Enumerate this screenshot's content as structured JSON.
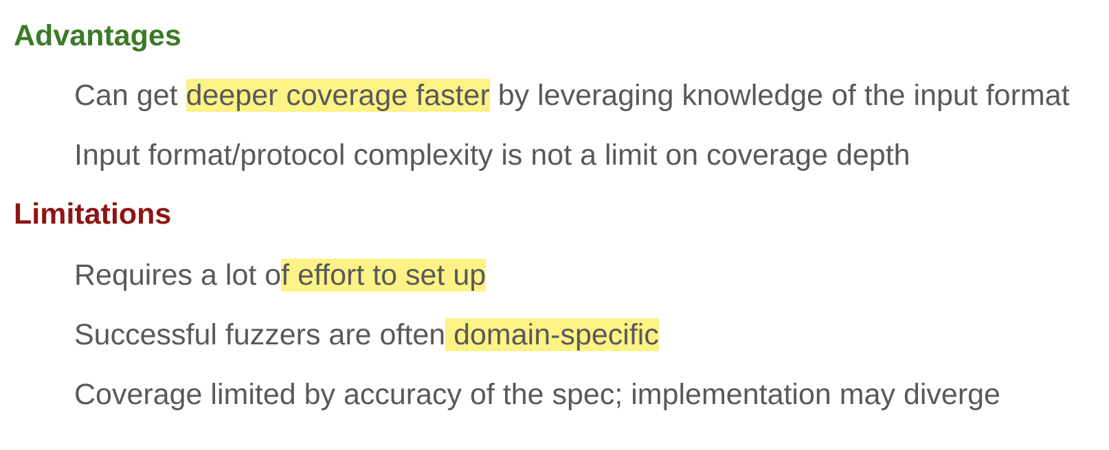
{
  "colors": {
    "advantages_heading": "#3b7a26",
    "limitations_heading": "#8f1414",
    "body_text": "#595959",
    "highlight": "#fcf286"
  },
  "advantages": {
    "heading": "Advantages",
    "items": [
      {
        "before": "Can get ",
        "highlight": "deeper coverage faster",
        "after": " by leveraging knowledge of the input format"
      },
      {
        "before": "Input format/protocol complexity is not a limit on coverage depth",
        "highlight": "",
        "after": ""
      }
    ]
  },
  "limitations": {
    "heading": "Limitations",
    "items": [
      {
        "before": "Requires a lot o",
        "highlight": "f effort to set up",
        "after": ""
      },
      {
        "before": "Successful fuzzers are often",
        "highlight": " domain-specific",
        "after": ""
      },
      {
        "before": "Coverage limited by accuracy of the spec; implementation may diverge",
        "highlight": "",
        "after": ""
      }
    ]
  }
}
